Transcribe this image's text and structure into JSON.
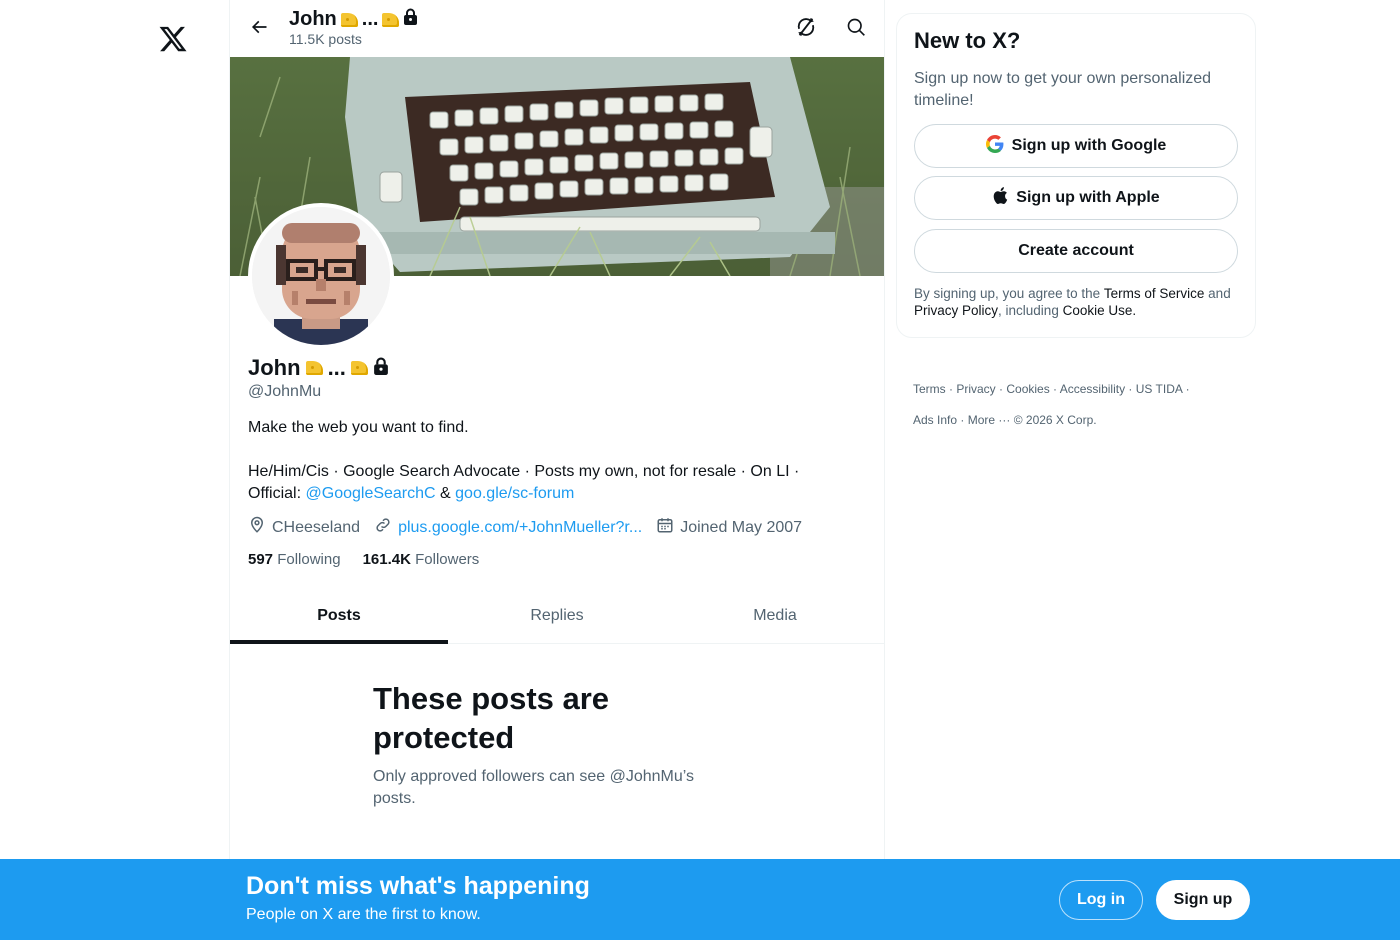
{
  "header": {
    "name": "John",
    "name_ellipsis": "...",
    "posts_count": "11.5K posts"
  },
  "profile": {
    "display_name": "John",
    "name_ellipsis": "...",
    "handle": "@JohnMu",
    "bio_line1": "Make the web you want to find.",
    "bio_line2_text": "He/Him/Cis · Google Search Advocate · Posts my own, not for resale · On LI  · Official: ",
    "bio_link1": "@GoogleSearchC",
    "bio_amp": " & ",
    "bio_link2": "goo.gle/sc-forum",
    "location": "CHeeseland",
    "website": "plus.google.com/+JohnMueller?r...",
    "joined": "Joined May 2007",
    "following_count": "597",
    "following_label": "Following",
    "followers_count": "161.4K",
    "followers_label": "Followers"
  },
  "tabs": [
    {
      "label": "Posts"
    },
    {
      "label": "Replies"
    },
    {
      "label": "Media"
    }
  ],
  "protected": {
    "title": "These posts are protected",
    "subtitle": "Only approved followers can see @JohnMu’s posts."
  },
  "signup_card": {
    "title": "New to X?",
    "subtitle": "Sign up now to get your own personalized timeline!",
    "google_label": "Sign up with Google",
    "apple_label": "Sign up with Apple",
    "create_label": "Create account",
    "legal_prefix": "By signing up, you agree to the ",
    "terms": "Terms of Service",
    "legal_and": " and ",
    "privacy": "Privacy Policy",
    "legal_including": ", including ",
    "cookie": "Cookie Use."
  },
  "footer": {
    "links": [
      "Terms",
      "Privacy",
      "Cookies",
      "Accessibility",
      "US TIDA",
      "Ads Info",
      "More ···",
      "© 2026 X Corp."
    ]
  },
  "bottom_bar": {
    "title": "Don't miss what's happening",
    "subtitle": "People on X are the first to know.",
    "login_label": "Log in",
    "signup_label": "Sign up"
  },
  "colors": {
    "accent": "#1d9bf0",
    "text": "#0f1419",
    "muted": "#536471",
    "border": "#eff3f4"
  },
  "icons": [
    "x-logo-icon",
    "back-arrow-icon",
    "sync-icon",
    "search-icon",
    "cheese-icon",
    "lock-icon",
    "location-icon",
    "link-icon",
    "calendar-icon",
    "google-icon",
    "apple-icon"
  ]
}
